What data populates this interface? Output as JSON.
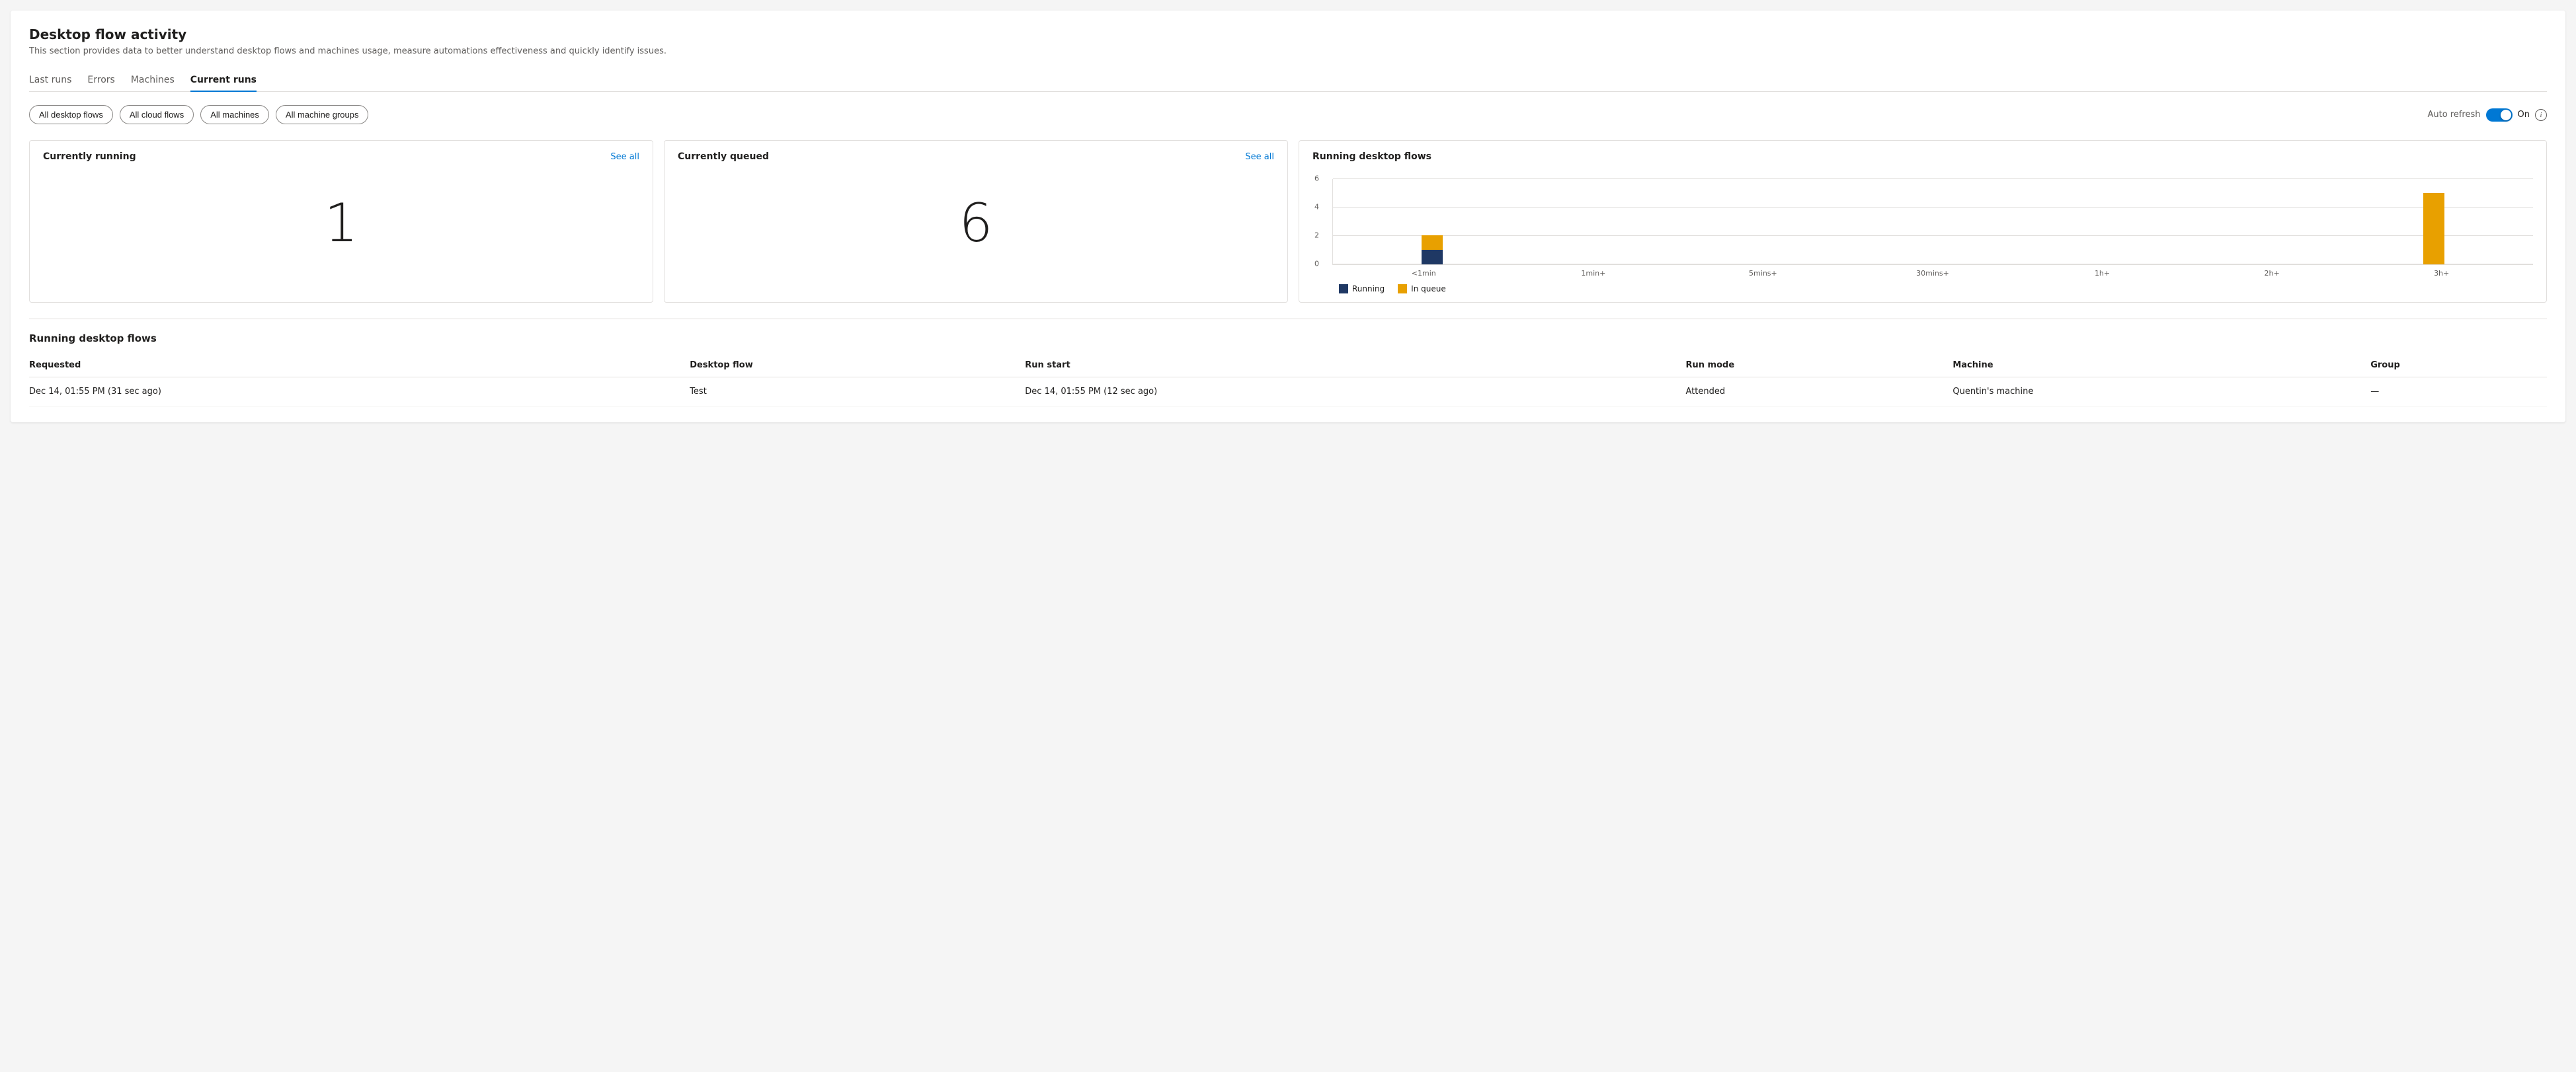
{
  "page": {
    "title": "Desktop flow activity",
    "subtitle": "This section provides data to better understand desktop flows and machines usage, measure automations effectiveness and quickly identify issues."
  },
  "tabs": [
    {
      "id": "last-runs",
      "label": "Last runs",
      "active": false
    },
    {
      "id": "errors",
      "label": "Errors",
      "active": false
    },
    {
      "id": "machines",
      "label": "Machines",
      "active": false
    },
    {
      "id": "current-runs",
      "label": "Current runs",
      "active": true
    }
  ],
  "filters": [
    {
      "id": "all-desktop-flows",
      "label": "All desktop flows"
    },
    {
      "id": "all-cloud-flows",
      "label": "All cloud flows"
    },
    {
      "id": "all-machines",
      "label": "All machines"
    },
    {
      "id": "all-machine-groups",
      "label": "All machine groups"
    }
  ],
  "autoRefresh": {
    "label": "Auto refresh",
    "state": "On"
  },
  "currentlyRunning": {
    "title": "Currently running",
    "seeAllLabel": "See all",
    "value": "1"
  },
  "currentlyQueued": {
    "title": "Currently queued",
    "seeAllLabel": "See all",
    "value": "6"
  },
  "runningDesktopFlowsChart": {
    "title": "Running desktop flows",
    "yLabels": [
      "0",
      "2",
      "4",
      "6"
    ],
    "xLabels": [
      "<1min",
      "1min+",
      "5mins+",
      "30mins+",
      "1h+",
      "2h+",
      "3h+"
    ],
    "bars": [
      {
        "x": "<1min",
        "running": 1,
        "queue": 1
      },
      {
        "x": "1min+",
        "running": 0,
        "queue": 0
      },
      {
        "x": "5mins+",
        "running": 0,
        "queue": 0
      },
      {
        "x": "30mins+",
        "running": 0,
        "queue": 0
      },
      {
        "x": "1h+",
        "running": 0,
        "queue": 0
      },
      {
        "x": "2h+",
        "running": 0,
        "queue": 0
      },
      {
        "x": "3h+",
        "running": 0,
        "queue": 5
      }
    ],
    "legend": [
      {
        "id": "running",
        "label": "Running",
        "color": "#1f3864"
      },
      {
        "id": "in-queue",
        "label": "In queue",
        "color": "#e8a000"
      }
    ],
    "maxValue": 6
  },
  "runningTable": {
    "title": "Running desktop flows",
    "columns": [
      {
        "id": "requested",
        "label": "Requested"
      },
      {
        "id": "desktop-flow",
        "label": "Desktop flow"
      },
      {
        "id": "run-start",
        "label": "Run start"
      },
      {
        "id": "run-mode",
        "label": "Run mode"
      },
      {
        "id": "machine",
        "label": "Machine"
      },
      {
        "id": "group",
        "label": "Group"
      }
    ],
    "rows": [
      {
        "requested": "Dec 14, 01:55 PM (31 sec ago)",
        "desktopFlow": "Test",
        "runStart": "Dec 14, 01:55 PM (12 sec ago)",
        "runMode": "Attended",
        "machine": "Quentin's machine",
        "group": "—"
      }
    ]
  }
}
